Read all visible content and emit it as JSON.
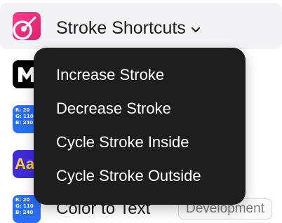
{
  "header": {
    "title": "Stroke Shortcuts",
    "chevron": "chevron-down-icon"
  },
  "rows": [
    {
      "icon": "bold-m-icon"
    },
    {
      "icon": "rgb-values-icon",
      "icon_text": [
        "R: 20",
        "G: 110",
        "B: 240"
      ]
    },
    {
      "icon": "font-aa-icon",
      "icon_text": "Aa"
    },
    {
      "icon": "rgb-values-icon",
      "icon_text": [
        "R: 20",
        "G: 110",
        "B: 240"
      ],
      "label": "Color to Text",
      "badge": "Development"
    }
  ],
  "menu": {
    "items": [
      "Increase Stroke",
      "Decrease Stroke",
      "Cycle Stroke Inside",
      "Cycle Stroke Outside"
    ]
  },
  "colors": {
    "menu_bg": "#1e1e1e",
    "accent_blue": "#2b6dfc",
    "plugin_pink": "#f0307a"
  }
}
